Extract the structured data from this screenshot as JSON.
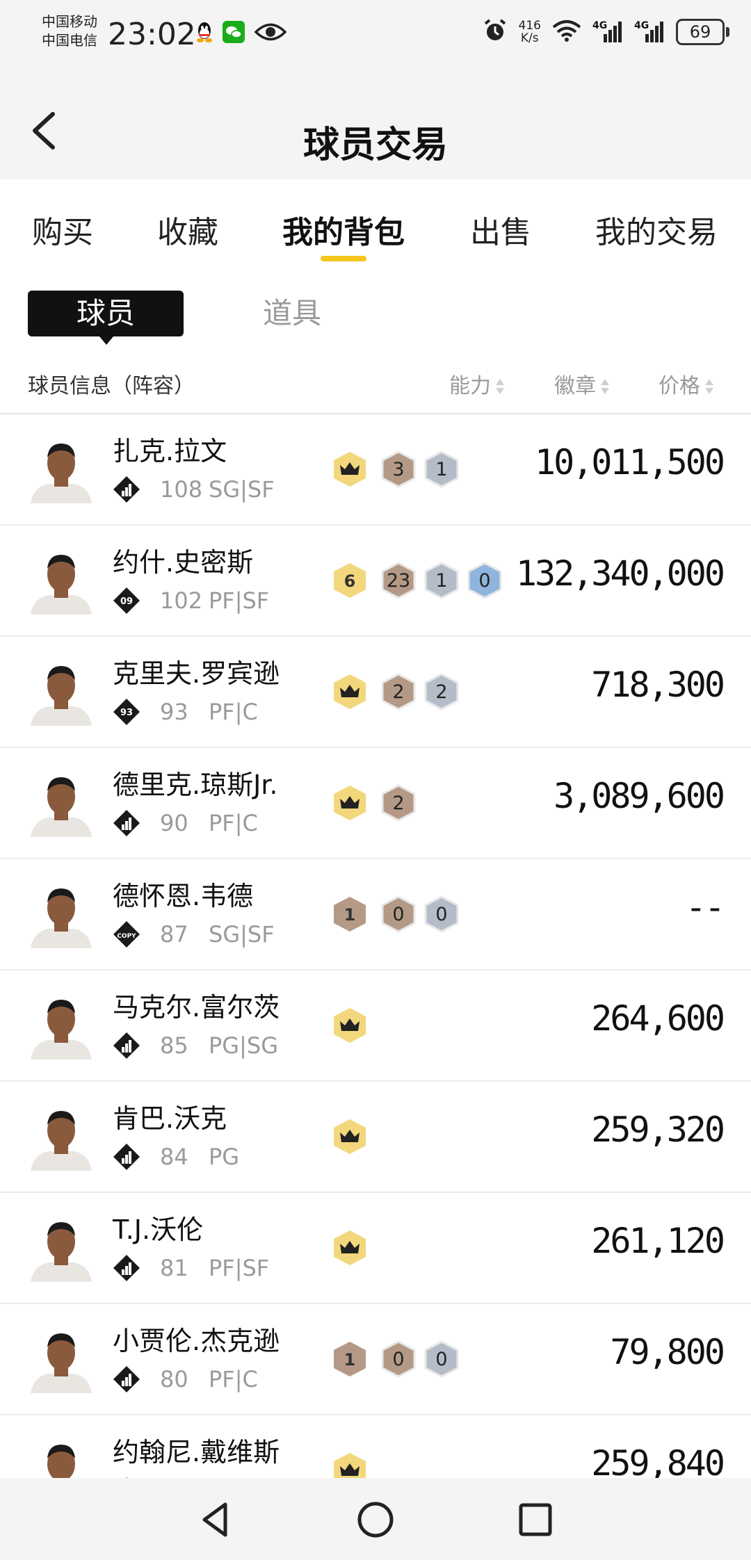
{
  "status_bar": {
    "carrier1": "中国移动",
    "carrier2": "中国电信",
    "time": "23:02",
    "netspeed_value": "416",
    "netspeed_unit": "K/s",
    "network1": "4G",
    "network2": "4G",
    "battery": "69"
  },
  "header": {
    "title": "球员交易"
  },
  "tabs": [
    {
      "label": "购买"
    },
    {
      "label": "收藏"
    },
    {
      "label": "我的背包"
    },
    {
      "label": "出售"
    },
    {
      "label": "我的交易"
    }
  ],
  "active_tab": "我的背包",
  "subtabs": {
    "active": "球员",
    "inactive": "道具"
  },
  "columns": {
    "info": "球员信息（阵容）",
    "ability": "能力",
    "badge": "徽章",
    "price": "价格"
  },
  "colors": {
    "accent": "#f5c518",
    "crown_badge": "#f2d77c",
    "bronze": "#b49a86",
    "silver": "#b5bcc9",
    "blue": "#8fb5dc",
    "muted": "#9a9a9a"
  },
  "players": [
    {
      "name": "扎克.拉文",
      "rank_icon": "bars-icon",
      "rank_text": "",
      "rating": "108",
      "position": "SG|SF",
      "crown": true,
      "crown_num": "",
      "badges": [
        {
          "tier": "bronze",
          "count": "3"
        },
        {
          "tier": "silver",
          "count": "1"
        }
      ],
      "price": "10,011,500"
    },
    {
      "name": "约什.史密斯",
      "rank_icon": "rank-09-icon",
      "rank_text": "09",
      "rating": "102",
      "position": "PF|SF",
      "crown": true,
      "crown_num": "6",
      "badges": [
        {
          "tier": "bronze",
          "count": "23"
        },
        {
          "tier": "silver",
          "count": "1"
        },
        {
          "tier": "blue",
          "count": "0"
        }
      ],
      "price": "132,340,000"
    },
    {
      "name": "克里夫.罗宾逊",
      "rank_icon": "rank-93-icon",
      "rank_text": "93",
      "rating": "93",
      "position": "PF|C",
      "crown": true,
      "crown_num": "",
      "badges": [
        {
          "tier": "bronze",
          "count": "2"
        },
        {
          "tier": "silver",
          "count": "2"
        }
      ],
      "price": "718,300"
    },
    {
      "name": "德里克.琼斯Jr.",
      "rank_icon": "bars-icon",
      "rank_text": "",
      "rating": "90",
      "position": "PF|C",
      "crown": true,
      "crown_num": "",
      "badges": [
        {
          "tier": "bronze",
          "count": "2"
        }
      ],
      "price": "3,089,600"
    },
    {
      "name": "德怀恩.韦德",
      "rank_icon": "copy-icon",
      "rank_text": "COPY",
      "rating": "87",
      "position": "SG|SF",
      "crown": false,
      "crown_num": "1",
      "badges": [
        {
          "tier": "bronze",
          "count": "0"
        },
        {
          "tier": "silver",
          "count": "0"
        }
      ],
      "price": "--"
    },
    {
      "name": "马克尔.富尔茨",
      "rank_icon": "bars-icon",
      "rank_text": "",
      "rating": "85",
      "position": "PG|SG",
      "crown": true,
      "crown_num": "",
      "badges": [],
      "price": "264,600"
    },
    {
      "name": "肯巴.沃克",
      "rank_icon": "bars-icon",
      "rank_text": "",
      "rating": "84",
      "position": "PG",
      "crown": true,
      "crown_num": "",
      "badges": [],
      "price": "259,320"
    },
    {
      "name": "T.J.沃伦",
      "rank_icon": "bars-icon",
      "rank_text": "",
      "rating": "81",
      "position": "PF|SF",
      "crown": true,
      "crown_num": "",
      "badges": [],
      "price": "261,120"
    },
    {
      "name": "小贾伦.杰克逊",
      "rank_icon": "bars-icon",
      "rank_text": "",
      "rating": "80",
      "position": "PF|C",
      "crown": false,
      "crown_num": "1",
      "badges": [
        {
          "tier": "bronze",
          "count": "0"
        },
        {
          "tier": "silver",
          "count": "0"
        }
      ],
      "price": "79,800"
    },
    {
      "name": "约翰尼.戴维斯",
      "rank_icon": "bars-icon",
      "rank_text": "",
      "rating": "",
      "position": "",
      "crown": true,
      "crown_num": "",
      "badges": [],
      "price": "259,840"
    }
  ]
}
